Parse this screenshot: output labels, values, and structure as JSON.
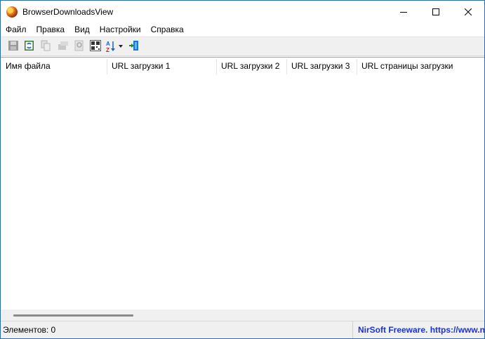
{
  "window": {
    "title": "BrowserDownloadsView"
  },
  "menu": {
    "items": [
      "Файл",
      "Правка",
      "Вид",
      "Настройки",
      "Справка"
    ]
  },
  "toolbar": {
    "buttons": [
      "save-icon",
      "refresh-icon",
      "copy-icon",
      "properties-icon",
      "find-icon",
      "html-report-icon",
      "sort-az-icon",
      "exit-icon"
    ]
  },
  "list": {
    "columns": [
      "Имя файла",
      "URL загрузки 1",
      "URL загрузки 2",
      "URL загрузки 3",
      "URL страницы загрузки"
    ],
    "rows": []
  },
  "status": {
    "items_count": "Элементов: 0",
    "link": "NirSoft Freeware. https://www.nirsoft.net"
  },
  "colors": {
    "link": "#1a33d6",
    "chrome": "#f0f0f0"
  }
}
